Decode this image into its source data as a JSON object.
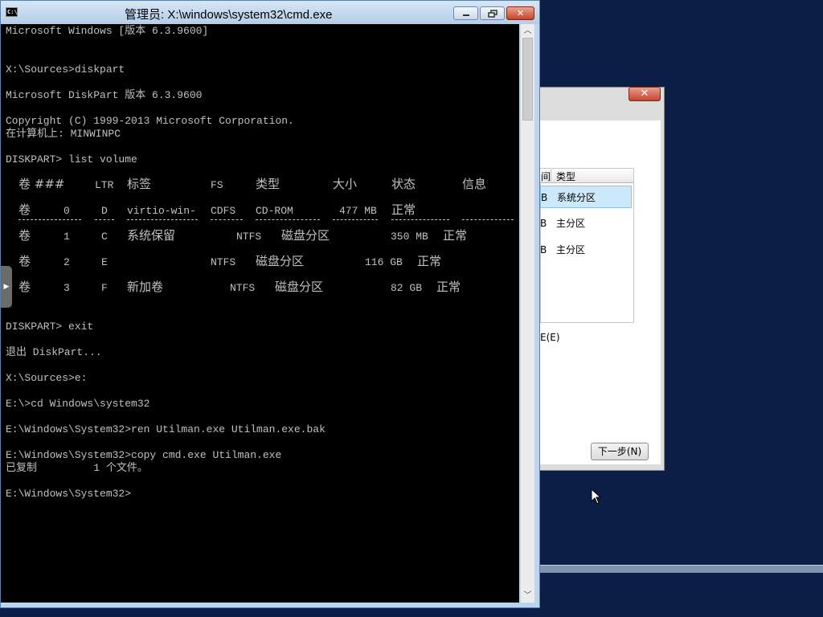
{
  "cmd": {
    "title": "管理员: X:\\windows\\system32\\cmd.exe",
    "icon_text": "C:\\",
    "buttons": {
      "min_icon": "minimize-icon",
      "max_icon": "maximize-icon",
      "close": "✕"
    },
    "lines": {
      "l1": "Microsoft Windows [版本 6.3.9600]",
      "l2": "X:\\Sources>diskpart",
      "l3": "Microsoft DiskPart 版本 6.3.9600",
      "l4": "Copyright (C) 1999-2013 Microsoft Corporation.",
      "l5": "在计算机上: MINWINPC",
      "l6": "DISKPART> list volume",
      "l7": "DISKPART> exit",
      "l8": "退出 DiskPart...",
      "l9": "X:\\Sources>e:",
      "l10": "E:\\>cd Windows\\system32",
      "l11": "E:\\Windows\\System32>ren Utilman.exe Utilman.exe.bak",
      "l12": "E:\\Windows\\System32>copy cmd.exe Utilman.exe",
      "l13": "已复制         1 个文件。",
      "l14": "E:\\Windows\\System32>"
    },
    "volume_table": {
      "headers": [
        "卷 ###",
        "LTR",
        "标签",
        "FS",
        "类型",
        "大小",
        "状态",
        "信息"
      ],
      "rows": [
        {
          "vol": "卷",
          "num": "0",
          "ltr": "D",
          "label": "virtio-win-",
          "fs": "CDFS",
          "type": "CD-ROM",
          "size": "477 MB",
          "status": "正常"
        },
        {
          "vol": "卷",
          "num": "1",
          "ltr": "C",
          "label": "系统保留",
          "fs": "NTFS",
          "type": "磁盘分区",
          "size": "350 MB",
          "status": "正常"
        },
        {
          "vol": "卷",
          "num": "2",
          "ltr": "E",
          "label": "",
          "fs": "NTFS",
          "type": "磁盘分区",
          "size": "116 GB",
          "status": "正常"
        },
        {
          "vol": "卷",
          "num": "3",
          "ltr": "F",
          "label": "新加卷",
          "fs": "NTFS",
          "type": "磁盘分区",
          "size": "82 GB",
          "status": "正常"
        }
      ]
    }
  },
  "setup": {
    "close": "✕",
    "table_header": {
      "col1": "间",
      "col2": "类型"
    },
    "rows": [
      {
        "size": "B",
        "type": "系统分区"
      },
      {
        "size": "B",
        "type": "主分区"
      },
      {
        "size": "B",
        "type": "主分区"
      }
    ],
    "drive_options": "E(E)",
    "next_button": "下一步(N)"
  }
}
